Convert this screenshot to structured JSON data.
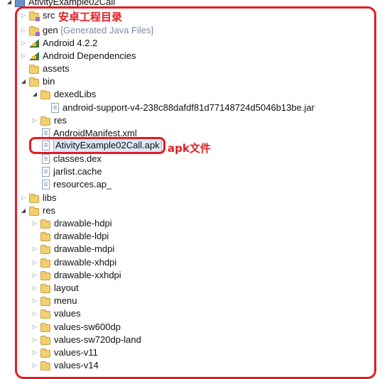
{
  "colors": {
    "annotation": "#e51c23",
    "selection": "#dbe8f7",
    "folder": "#f3cf6d"
  },
  "tree": {
    "project": "AtivityExample02Call",
    "src": "src",
    "gen": "gen",
    "gen_note": "[Generated Java Files]",
    "android_lib": "Android 4.2.2",
    "android_deps": "Android Dependencies",
    "assets": "assets",
    "bin": "bin",
    "dexedLibs": "dexedLibs",
    "support_jar": "android-support-v4-238c88dafdf81d77148724d5046b13be.jar",
    "bin_res": "res",
    "manifest": "AndroidManifest.xml",
    "apk": "AtivityExample02Call.apk",
    "classes": "classes.dex",
    "jarlist": "jarlist.cache",
    "resources_ap": "resources.ap_",
    "libs": "libs",
    "res": "res",
    "res_children": [
      "drawable-hdpi",
      "drawable-ldpi",
      "drawable-mdpi",
      "drawable-xhdpi",
      "drawable-xxhdpi",
      "layout",
      "menu",
      "values",
      "values-sw600dp",
      "values-sw720dp-land",
      "values-v11",
      "values-v14"
    ]
  },
  "annotations": {
    "project_dir": "安卓工程目录",
    "apk_file": "apk文件"
  }
}
